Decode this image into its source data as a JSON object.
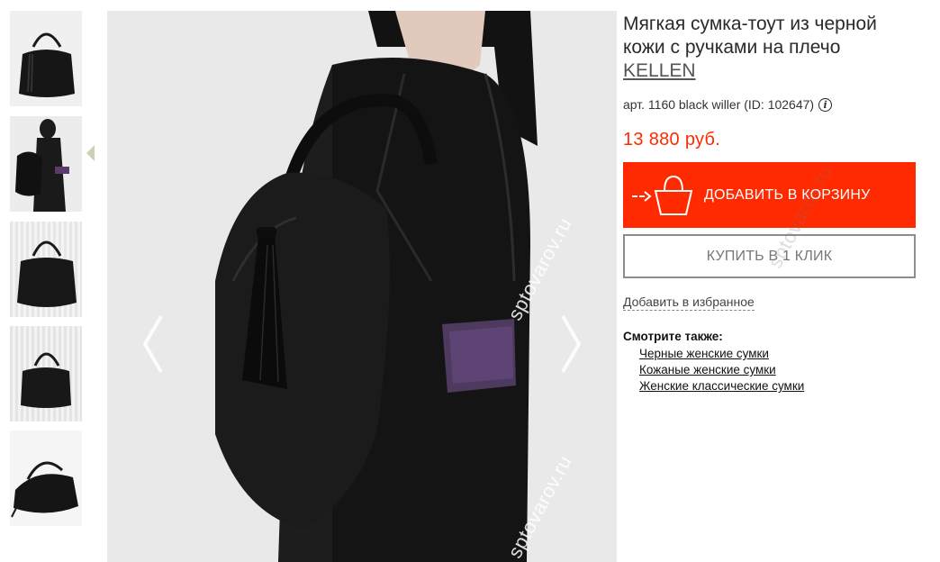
{
  "product": {
    "title": "Мягкая сумка-тоут из черной кожи с ручками на плечо",
    "brand": "KELLEN",
    "article": "арт. 1160 black willer (ID: 102647)",
    "info_icon": "info-icon",
    "price": "13 880 руб."
  },
  "actions": {
    "add_to_cart": "ДОБАВИТЬ В КОРЗИНУ",
    "buy_one_click": "КУПИТЬ В 1 КЛИК",
    "add_to_favorites": "Добавить в избранное"
  },
  "see_also": {
    "title": "Смотрите также:",
    "links": [
      "Черные женские сумки",
      "Кожаные женские сумки",
      "Женские классические сумки"
    ]
  },
  "gallery": {
    "thumbnail_count": 5,
    "selected_thumbnail": 2,
    "watermark": "sptovarov.ru"
  },
  "colors": {
    "accent": "#ff2a00",
    "button_border": "#8c8c8c"
  }
}
